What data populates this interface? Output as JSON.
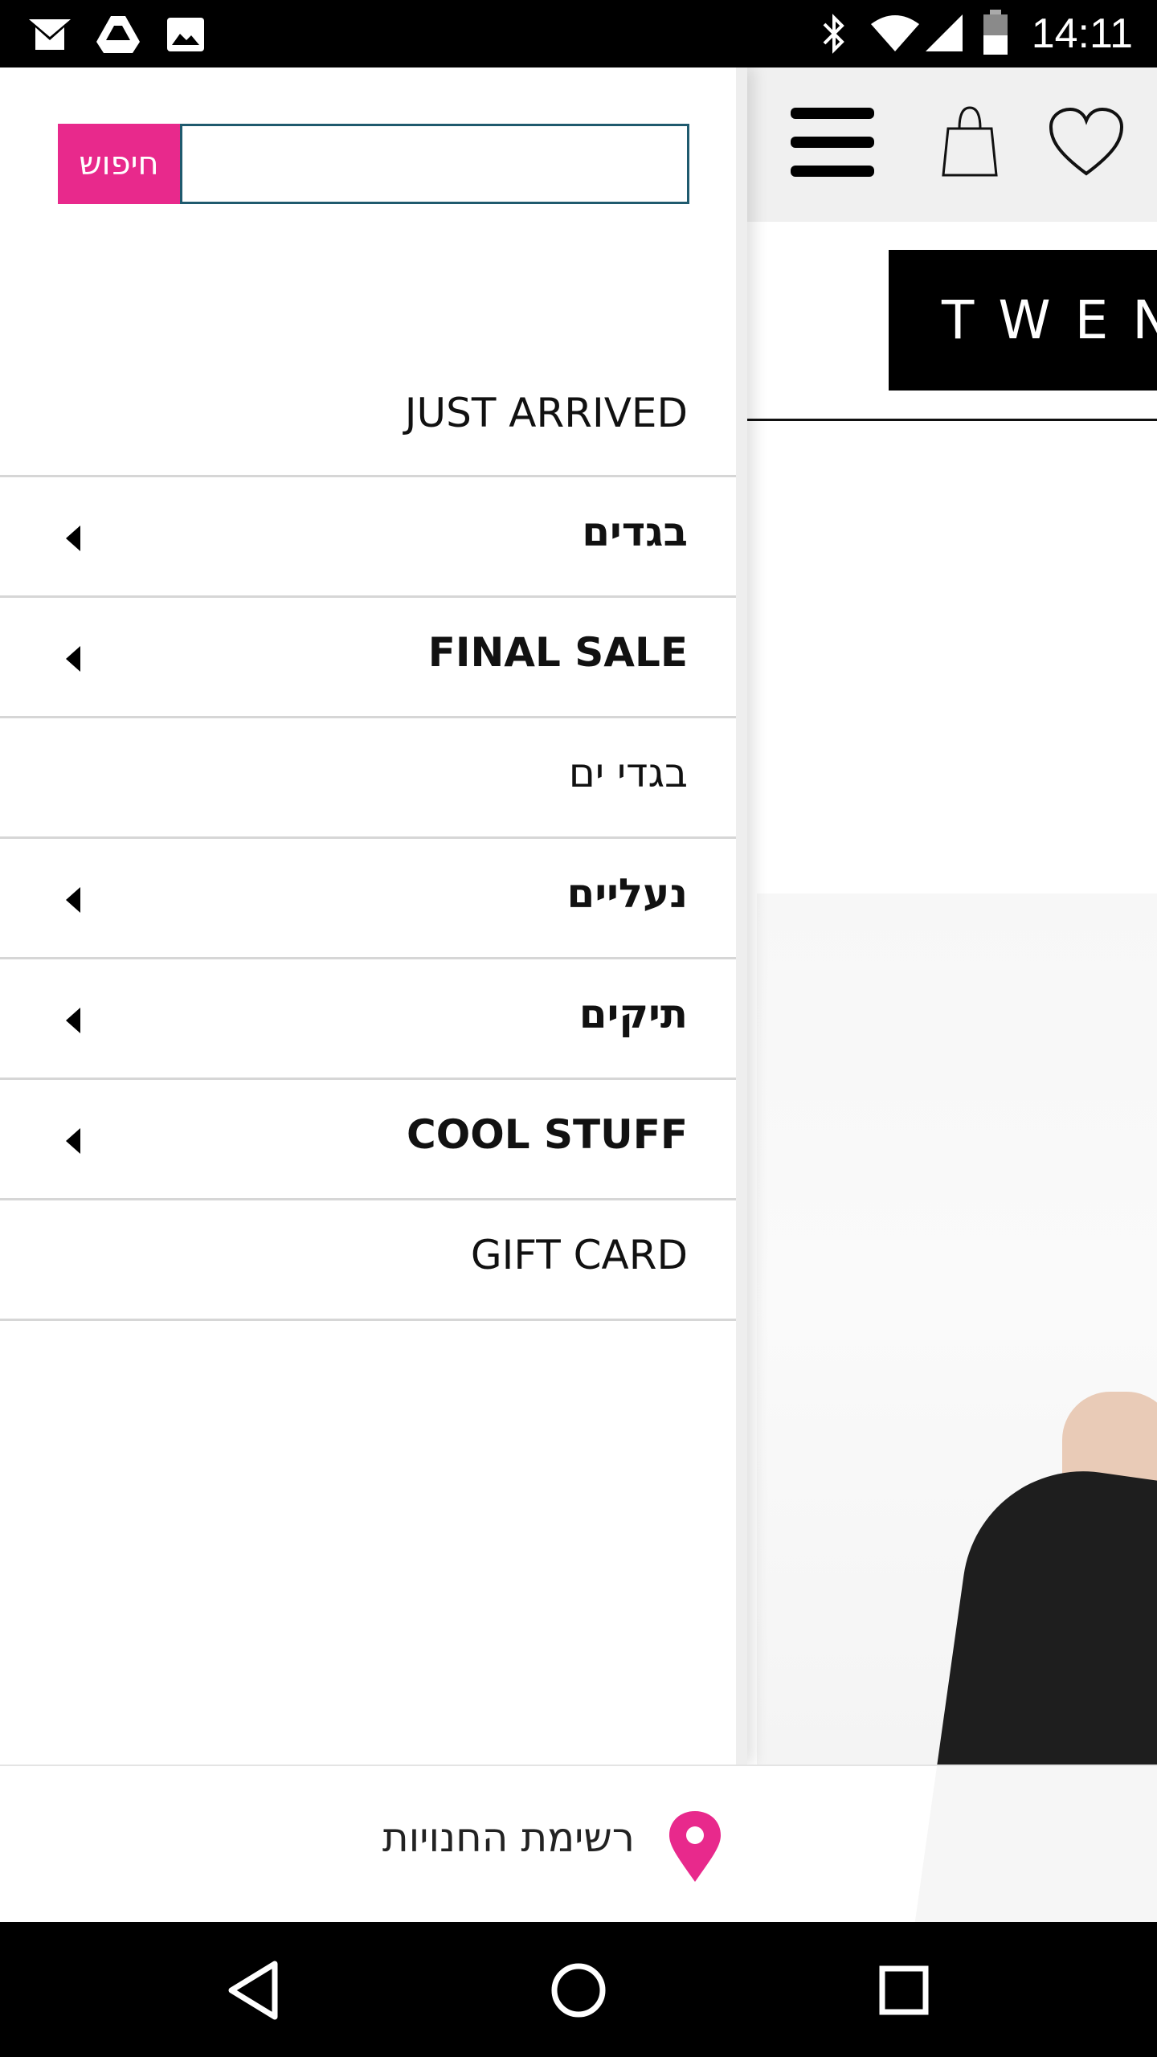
{
  "status_bar": {
    "time": "14:11",
    "left_icons": [
      "gmail-icon",
      "drive-icon",
      "image-icon"
    ],
    "right_icons": [
      "bluetooth-icon",
      "wifi-icon",
      "signal-icon",
      "battery-icon"
    ]
  },
  "drawer": {
    "search": {
      "button_label": "חיפוש",
      "input_value": "",
      "input_placeholder": ""
    },
    "menu_items": [
      {
        "label": "JUST ARRIVED",
        "has_submenu": false,
        "bold": false
      },
      {
        "label": "בגדים",
        "has_submenu": true,
        "bold": true
      },
      {
        "label": "FINAL SALE",
        "has_submenu": true,
        "bold": true
      },
      {
        "label": "בגדי ים",
        "has_submenu": false,
        "bold": false
      },
      {
        "label": "נעליים",
        "has_submenu": true,
        "bold": true
      },
      {
        "label": "תיקים",
        "has_submenu": true,
        "bold": true
      },
      {
        "label": "COOL STUFF",
        "has_submenu": true,
        "bold": true
      },
      {
        "label": "GIFT CARD",
        "has_submenu": false,
        "bold": false
      }
    ]
  },
  "page_behind": {
    "header_icons": [
      "hamburger-menu-icon",
      "shopping-bag-icon",
      "heart-icon"
    ],
    "brand_logo_text": "TWEN"
  },
  "store_bar": {
    "label": "רשימת החנויות",
    "icon": "location-pin-icon"
  },
  "nav_bar": {
    "buttons": [
      "back-icon",
      "home-icon",
      "recents-icon"
    ]
  },
  "colors": {
    "accent_pink": "#e8298c",
    "search_border": "#1f5a6e",
    "divider": "#d6d6d6"
  }
}
